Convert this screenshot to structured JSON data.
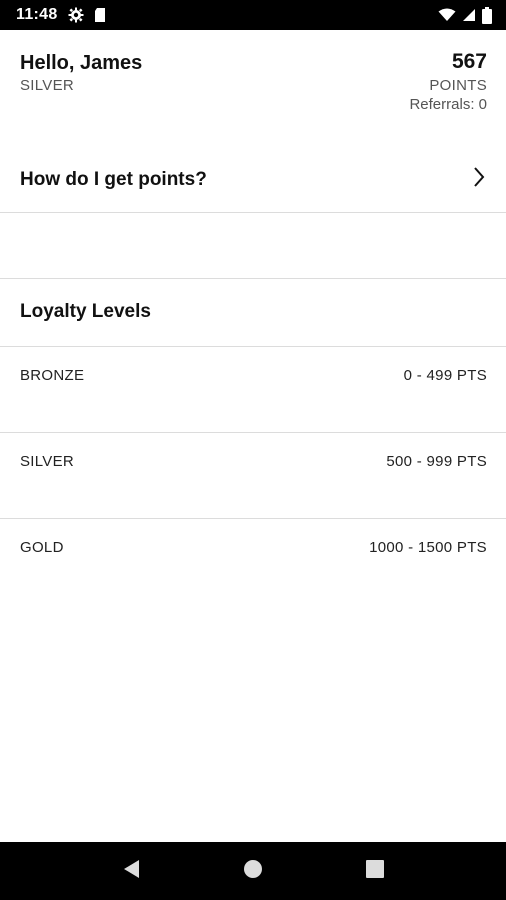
{
  "status_bar": {
    "time": "11:48",
    "icons": [
      "gear-icon",
      "sd-card-icon",
      "wifi-icon",
      "signal-icon",
      "battery-icon"
    ]
  },
  "header": {
    "greeting": "Hello, James",
    "tier": "SILVER",
    "points": "567",
    "points_label": "POINTS",
    "referrals": "Referrals: 0"
  },
  "how_row": {
    "label": "How do I get points?",
    "icon": "chevron-right-icon"
  },
  "loyalty": {
    "title": "Loyalty Levels",
    "levels": [
      {
        "name": "BRONZE",
        "range": "0 - 499 PTS"
      },
      {
        "name": "SILVER",
        "range": "500 - 999 PTS"
      },
      {
        "name": "GOLD",
        "range": "1000 - 1500 PTS"
      }
    ]
  },
  "nav_bar": {
    "icons": [
      "back-icon",
      "home-icon",
      "recents-icon"
    ]
  },
  "colors": {
    "status_bar_bg": "#000000",
    "nav_bar_bg": "#000000",
    "divider": "#dcdcdc",
    "muted_text": "#555555"
  }
}
